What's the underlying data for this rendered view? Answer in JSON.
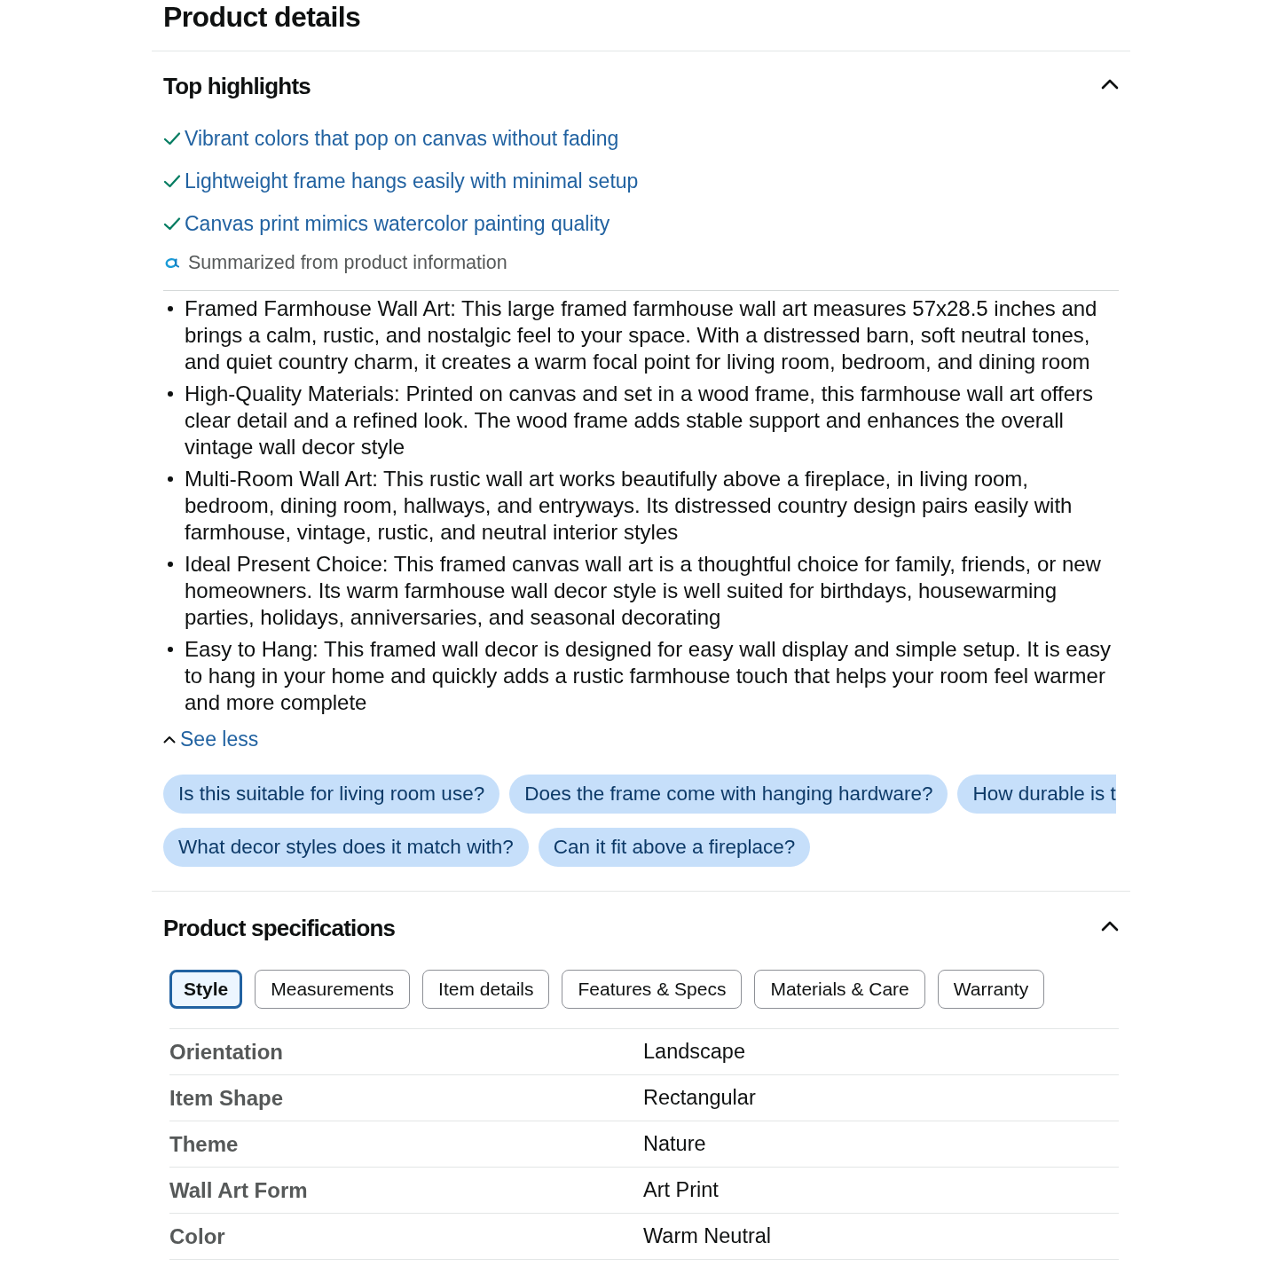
{
  "title": "Product details",
  "top_highlights": {
    "heading": "Top highlights",
    "expanded": true,
    "highlights": [
      "Vibrant colors that pop on canvas without fading",
      "Lightweight frame hangs easily with minimal setup",
      "Canvas print mimics watercolor painting quality"
    ],
    "source_note": "Summarized from product information",
    "bullets": [
      "Framed Farmhouse Wall Art: This large framed farmhouse wall art measures 57x28.5 inches and brings a calm, rustic, and nostalgic feel to your space. With a distressed barn, soft neutral tones, and quiet country charm, it creates a warm focal point for living room, bedroom, and dining room",
      "High-Quality Materials: Printed on canvas and set in a wood frame, this farmhouse wall art offers clear detail and a refined look. The wood frame adds stable support and enhances the overall vintage wall decor style",
      "Multi-Room Wall Art: This rustic wall art works beautifully above a fireplace, in living room, bedroom, dining room, hallways, and entryways. Its distressed country design pairs easily with farmhouse, vintage, rustic, and neutral interior styles",
      "Ideal Present Choice: This framed canvas wall art is a thoughtful choice for family, friends, or new homeowners. Its warm farmhouse wall decor style is well suited for birthdays, housewarming parties, holidays, anniversaries, and seasonal decorating",
      "Easy to Hang: This framed wall decor is designed for easy wall display and simple setup. It is easy to hang in your home and quickly adds a rustic farmhouse touch that helps your room feel warmer and more complete"
    ],
    "toggle": {
      "label": "See less",
      "expanded": true
    },
    "question_rows": [
      [
        {
          "label": "Is this suitable for living room use?",
          "clipped": false
        },
        {
          "label": "Does the frame come with hanging hardware?",
          "clipped": false
        },
        {
          "label": "How durable is t",
          "clipped": true
        }
      ],
      [
        {
          "label": "What decor styles does it match with?",
          "clipped": false
        },
        {
          "label": "Can it fit above a fireplace?",
          "clipped": false
        }
      ]
    ]
  },
  "product_specifications": {
    "heading": "Product specifications",
    "expanded": true,
    "tabs": [
      {
        "label": "Style",
        "selected": true
      },
      {
        "label": "Measurements",
        "selected": false
      },
      {
        "label": "Item details",
        "selected": false
      },
      {
        "label": "Features & Specs",
        "selected": false
      },
      {
        "label": "Materials & Care",
        "selected": false
      },
      {
        "label": "Warranty",
        "selected": false
      }
    ],
    "rows": [
      {
        "label": "Orientation",
        "value": "Landscape"
      },
      {
        "label": "Item Shape",
        "value": "Rectangular"
      },
      {
        "label": "Theme",
        "value": "Nature"
      },
      {
        "label": "Wall Art Form",
        "value": "Art Print"
      },
      {
        "label": "Color",
        "value": "Warm Neutral"
      }
    ]
  }
}
